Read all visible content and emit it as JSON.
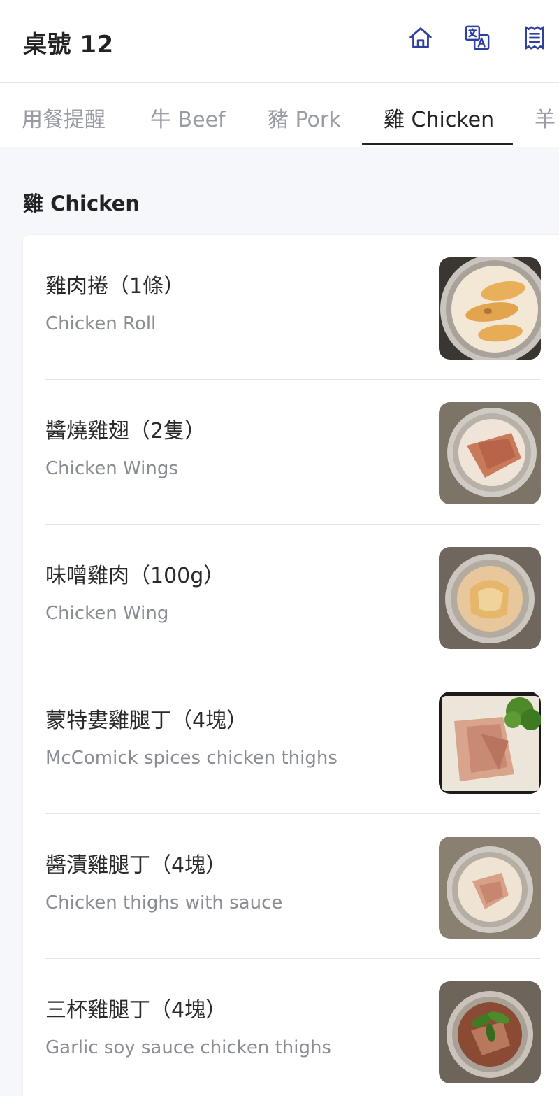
{
  "header": {
    "title": "桌號 12",
    "icons": [
      "home-icon",
      "translate-icon",
      "receipt-icon"
    ],
    "accent": "#2f3f9e"
  },
  "tabs": [
    {
      "label": "用餐提醒",
      "active": false
    },
    {
      "label": "牛 Beef",
      "active": false
    },
    {
      "label": "豬 Pork",
      "active": false
    },
    {
      "label": "雞 Chicken",
      "active": true
    },
    {
      "label": "羊",
      "active": false
    }
  ],
  "section": {
    "title": "雞 Chicken"
  },
  "items": [
    {
      "name": "雞肉捲（1條）",
      "desc": "Chicken Roll",
      "image": "chicken-roll-photo"
    },
    {
      "name": "醬燒雞翅（2隻）",
      "desc": "Chicken Wings",
      "image": "chicken-wings-photo"
    },
    {
      "name": "味噌雞肉（100g）",
      "desc": "Chicken Wing",
      "image": "miso-chicken-photo"
    },
    {
      "name": "蒙特婁雞腿丁（4塊）",
      "desc": "McComick spices chicken thighs",
      "image": "montreal-chicken-photo"
    },
    {
      "name": "醬漬雞腿丁（4塊）",
      "desc": "Chicken thighs with sauce",
      "image": "sauce-chicken-photo"
    },
    {
      "name": "三杯雞腿丁（4塊）",
      "desc": "Garlic soy sauce chicken thighs",
      "image": "three-cup-chicken-photo"
    }
  ]
}
